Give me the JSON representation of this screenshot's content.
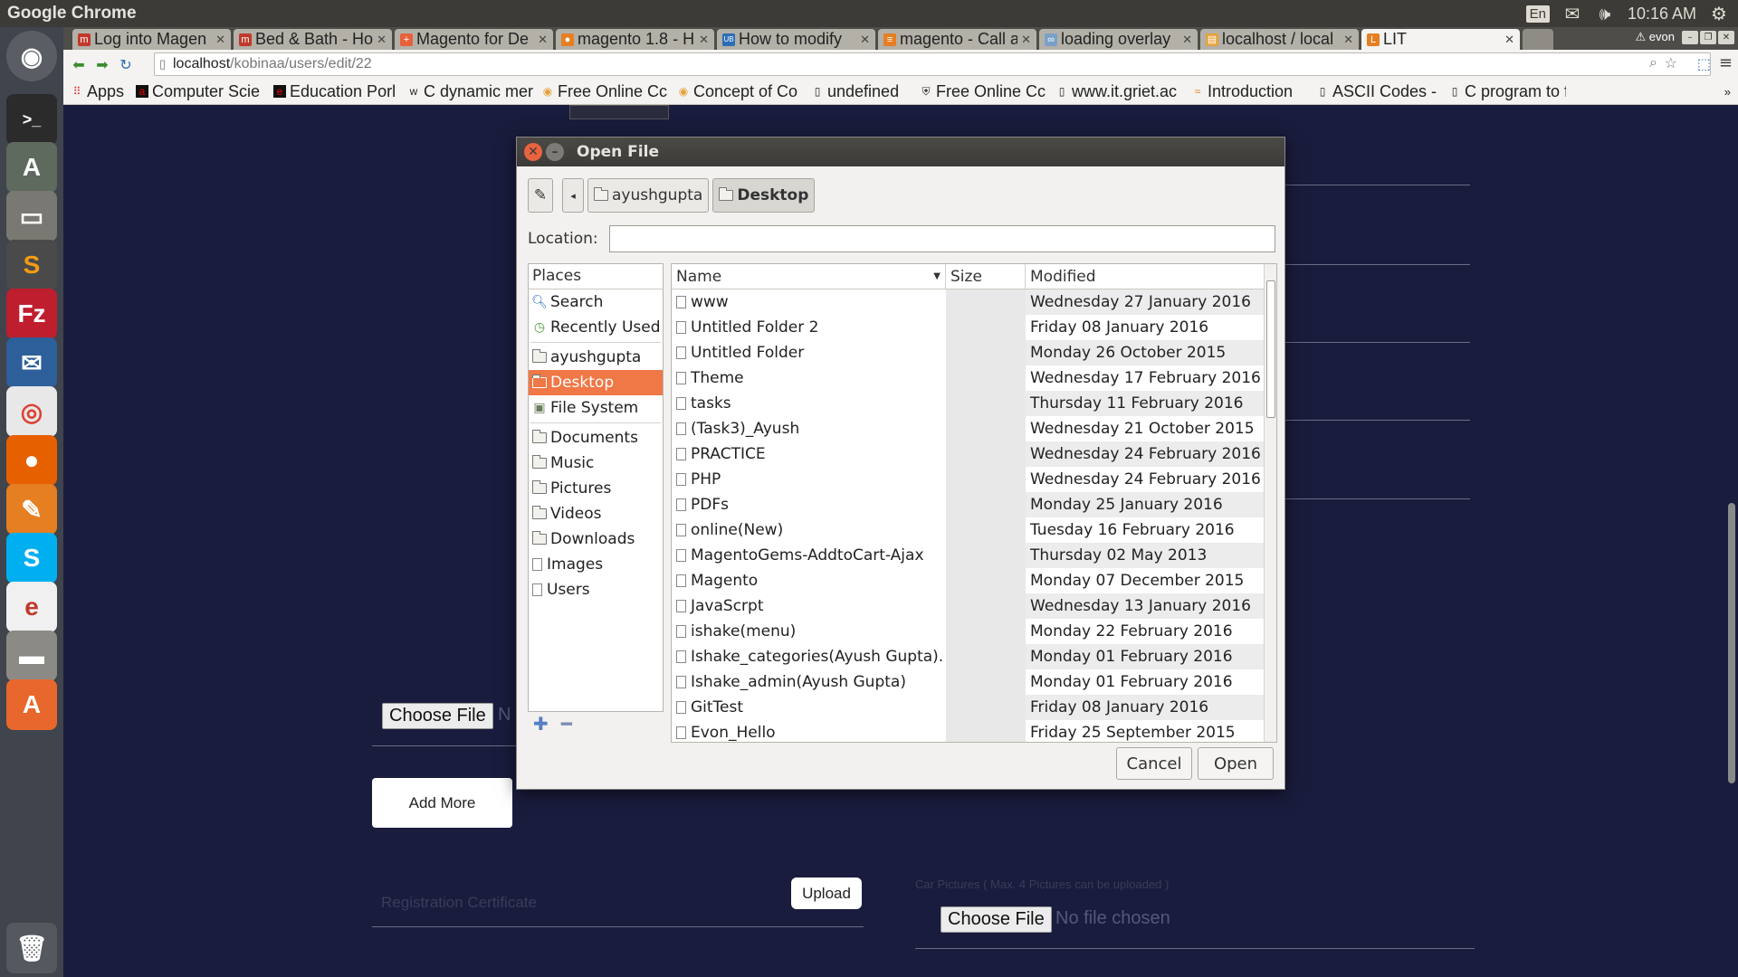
{
  "top_panel": {
    "app_title": "Google Chrome",
    "keyboard": "En",
    "clock": "10:16 AM"
  },
  "tabs": [
    {
      "title": "Log into Magen",
      "fav_color": "#c0392b",
      "fav": "m"
    },
    {
      "title": "Bed & Bath - Ho",
      "fav_color": "#c0392b",
      "fav": "m"
    },
    {
      "title": "Magento for De",
      "fav_color": "#e8603c",
      "fav": "+"
    },
    {
      "title": "magento 1.8 - H",
      "fav_color": "#e67e22",
      "fav": "●"
    },
    {
      "title": "How to modify",
      "fav_color": "#2d6db5",
      "fav": "UB"
    },
    {
      "title": "magento - Call a",
      "fav_color": "#e67e22",
      "fav": "≡"
    },
    {
      "title": "loading overlay",
      "fav_color": "#7aa0c8",
      "fav": "∞"
    },
    {
      "title": "localhost / local",
      "fav_color": "#e6a23c",
      "fav": "▤"
    },
    {
      "title": "LIT",
      "fav_color": "#e67e22",
      "fav": "L"
    }
  ],
  "profile_name": "evon",
  "omnibox": {
    "host": "localhost",
    "path": "/kobinaa/users/edit/22"
  },
  "bookmarks": [
    {
      "label": "Apps"
    },
    {
      "label": "Computer Scie"
    },
    {
      "label": "Education Porl"
    },
    {
      "label": "C dynamic mer"
    },
    {
      "label": "Free Online Cc"
    },
    {
      "label": "Concept of Co"
    },
    {
      "label": "undefined"
    },
    {
      "label": "Free Online Cc"
    },
    {
      "label": "www.it.griet.ac"
    },
    {
      "label": "Introduction"
    },
    {
      "label": "ASCII Codes - T"
    },
    {
      "label": "C program to f"
    }
  ],
  "page": {
    "choose_file_label": "Choose File",
    "choose_file_partial": "N",
    "add_more_label": "Add More",
    "upload_label": "Upload",
    "registration_placeholder": "Registration Certificate",
    "car_pictures_label": "Car Pictures ( Max. 4 Pictures can be uploaded )",
    "choose_file_label_2": "Choose File",
    "no_file_chosen": "No file chosen"
  },
  "dialog": {
    "title": "Open File",
    "pathbar": [
      "ayushgupta",
      "Desktop"
    ],
    "location_label": "Location:",
    "location_value": "",
    "places_header": "Places",
    "places": [
      {
        "label": "Search",
        "icon": "search-icon"
      },
      {
        "label": "Recently Used",
        "icon": "recent-icon"
      },
      {
        "label": "ayushgupta",
        "icon": "folder-icon"
      },
      {
        "label": "Desktop",
        "icon": "folder-icon",
        "selected": true
      },
      {
        "label": "File System",
        "icon": "drive-icon"
      },
      {
        "label": "Documents",
        "icon": "folder-icon"
      },
      {
        "label": "Music",
        "icon": "folder-icon"
      },
      {
        "label": "Pictures",
        "icon": "folder-icon"
      },
      {
        "label": "Videos",
        "icon": "folder-icon"
      },
      {
        "label": "Downloads",
        "icon": "folder-icon"
      },
      {
        "label": "Images",
        "icon": "file-icon"
      },
      {
        "label": "Users",
        "icon": "file-icon"
      }
    ],
    "columns": {
      "name": "Name",
      "size": "Size",
      "modified": "Modified"
    },
    "files": [
      {
        "name": "www",
        "size": "",
        "modified": "Wednesday 27 January 2016"
      },
      {
        "name": "Untitled Folder 2",
        "size": "",
        "modified": "Friday 08 January 2016"
      },
      {
        "name": "Untitled Folder",
        "size": "",
        "modified": "Monday 26 October 2015"
      },
      {
        "name": "Theme",
        "size": "",
        "modified": "Wednesday 17 February 2016"
      },
      {
        "name": "tasks",
        "size": "",
        "modified": "Thursday 11 February 2016"
      },
      {
        "name": "(Task3)_Ayush",
        "size": "",
        "modified": "Wednesday 21 October 2015"
      },
      {
        "name": "PRACTICE",
        "size": "",
        "modified": "Wednesday 24 February 2016"
      },
      {
        "name": "PHP",
        "size": "",
        "modified": "Wednesday 24 February 2016"
      },
      {
        "name": "PDFs",
        "size": "",
        "modified": "Monday 25 January 2016"
      },
      {
        "name": "online(New)",
        "size": "",
        "modified": "Tuesday 16 February 2016"
      },
      {
        "name": "MagentoGems-AddtoCart-Ajax",
        "size": "",
        "modified": "Thursday 02 May 2013"
      },
      {
        "name": "Magento",
        "size": "",
        "modified": "Monday 07 December 2015"
      },
      {
        "name": "JavaScrpt",
        "size": "",
        "modified": "Wednesday 13 January 2016"
      },
      {
        "name": "ishake(menu)",
        "size": "",
        "modified": "Monday 22 February 2016"
      },
      {
        "name": "Ishake_categories(Ayush Gupta).",
        "size": "",
        "modified": "Monday 01 February 2016"
      },
      {
        "name": "Ishake_admin(Ayush Gupta)",
        "size": "",
        "modified": "Monday 01 February 2016"
      },
      {
        "name": "GitTest",
        "size": "",
        "modified": "Friday 08 January 2016"
      },
      {
        "name": "Evon_Hello",
        "size": "",
        "modified": "Friday 25 September 2015"
      }
    ],
    "cancel_label": "Cancel",
    "open_label": "Open"
  }
}
